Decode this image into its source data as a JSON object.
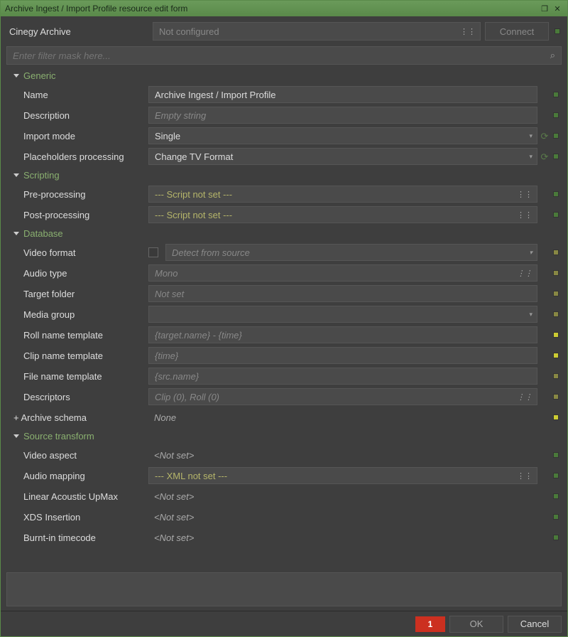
{
  "window": {
    "title": "Archive Ingest / Import Profile resource edit form"
  },
  "top": {
    "archive_label": "Cinegy Archive",
    "archive_value": "Not configured",
    "connect_label": "Connect"
  },
  "filter": {
    "placeholder": "Enter filter mask here..."
  },
  "sections": {
    "generic": {
      "title": "Generic",
      "name_label": "Name",
      "name_value": "Archive Ingest / Import Profile",
      "description_label": "Description",
      "description_value": "Empty string",
      "import_mode_label": "Import mode",
      "import_mode_value": "Single",
      "placeholders_label": "Placeholders processing",
      "placeholders_value": "Change TV Format"
    },
    "scripting": {
      "title": "Scripting",
      "pre_label": "Pre-processing",
      "pre_value": "--- Script not set ---",
      "post_label": "Post-processing",
      "post_value": "--- Script not set ---"
    },
    "database": {
      "title": "Database",
      "video_format_label": "Video format",
      "video_format_value": "Detect from source",
      "audio_type_label": "Audio type",
      "audio_type_value": "Mono",
      "target_folder_label": "Target folder",
      "target_folder_value": "Not set",
      "media_group_label": "Media group",
      "media_group_value": "",
      "roll_tmpl_label": "Roll name template",
      "roll_tmpl_value": "{target.name} - {time}",
      "clip_tmpl_label": "Clip name template",
      "clip_tmpl_value": "{time}",
      "file_tmpl_label": "File name template",
      "file_tmpl_value": "{src.name}",
      "descriptors_label": "Descriptors",
      "descriptors_value": "Clip (0), Roll (0)",
      "archive_schema_label": "Archive schema",
      "archive_schema_value": "None"
    },
    "transform": {
      "title": "Source transform",
      "video_aspect_label": "Video aspect",
      "video_aspect_value": "<Not set>",
      "audio_map_label": "Audio mapping",
      "audio_map_value": "--- XML not set ---",
      "upmax_label": "Linear Acoustic UpMax",
      "upmax_value": "<Not set>",
      "xds_label": "XDS Insertion",
      "xds_value": "<Not set>",
      "burntc_label": "Burnt-in timecode",
      "burntc_value": "<Not set>"
    }
  },
  "footer": {
    "error_count": "1",
    "ok_label": "OK",
    "cancel_label": "Cancel"
  }
}
